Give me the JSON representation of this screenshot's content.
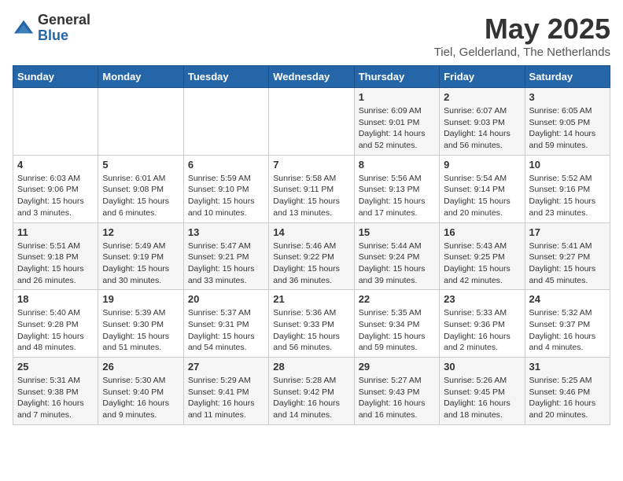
{
  "logo": {
    "general": "General",
    "blue": "Blue"
  },
  "title": "May 2025",
  "subtitle": "Tiel, Gelderland, The Netherlands",
  "days_of_week": [
    "Sunday",
    "Monday",
    "Tuesday",
    "Wednesday",
    "Thursday",
    "Friday",
    "Saturday"
  ],
  "weeks": [
    [
      {
        "day": "",
        "info": ""
      },
      {
        "day": "",
        "info": ""
      },
      {
        "day": "",
        "info": ""
      },
      {
        "day": "",
        "info": ""
      },
      {
        "day": "1",
        "info": "Sunrise: 6:09 AM\nSunset: 9:01 PM\nDaylight: 14 hours\nand 52 minutes."
      },
      {
        "day": "2",
        "info": "Sunrise: 6:07 AM\nSunset: 9:03 PM\nDaylight: 14 hours\nand 56 minutes."
      },
      {
        "day": "3",
        "info": "Sunrise: 6:05 AM\nSunset: 9:05 PM\nDaylight: 14 hours\nand 59 minutes."
      }
    ],
    [
      {
        "day": "4",
        "info": "Sunrise: 6:03 AM\nSunset: 9:06 PM\nDaylight: 15 hours\nand 3 minutes."
      },
      {
        "day": "5",
        "info": "Sunrise: 6:01 AM\nSunset: 9:08 PM\nDaylight: 15 hours\nand 6 minutes."
      },
      {
        "day": "6",
        "info": "Sunrise: 5:59 AM\nSunset: 9:10 PM\nDaylight: 15 hours\nand 10 minutes."
      },
      {
        "day": "7",
        "info": "Sunrise: 5:58 AM\nSunset: 9:11 PM\nDaylight: 15 hours\nand 13 minutes."
      },
      {
        "day": "8",
        "info": "Sunrise: 5:56 AM\nSunset: 9:13 PM\nDaylight: 15 hours\nand 17 minutes."
      },
      {
        "day": "9",
        "info": "Sunrise: 5:54 AM\nSunset: 9:14 PM\nDaylight: 15 hours\nand 20 minutes."
      },
      {
        "day": "10",
        "info": "Sunrise: 5:52 AM\nSunset: 9:16 PM\nDaylight: 15 hours\nand 23 minutes."
      }
    ],
    [
      {
        "day": "11",
        "info": "Sunrise: 5:51 AM\nSunset: 9:18 PM\nDaylight: 15 hours\nand 26 minutes."
      },
      {
        "day": "12",
        "info": "Sunrise: 5:49 AM\nSunset: 9:19 PM\nDaylight: 15 hours\nand 30 minutes."
      },
      {
        "day": "13",
        "info": "Sunrise: 5:47 AM\nSunset: 9:21 PM\nDaylight: 15 hours\nand 33 minutes."
      },
      {
        "day": "14",
        "info": "Sunrise: 5:46 AM\nSunset: 9:22 PM\nDaylight: 15 hours\nand 36 minutes."
      },
      {
        "day": "15",
        "info": "Sunrise: 5:44 AM\nSunset: 9:24 PM\nDaylight: 15 hours\nand 39 minutes."
      },
      {
        "day": "16",
        "info": "Sunrise: 5:43 AM\nSunset: 9:25 PM\nDaylight: 15 hours\nand 42 minutes."
      },
      {
        "day": "17",
        "info": "Sunrise: 5:41 AM\nSunset: 9:27 PM\nDaylight: 15 hours\nand 45 minutes."
      }
    ],
    [
      {
        "day": "18",
        "info": "Sunrise: 5:40 AM\nSunset: 9:28 PM\nDaylight: 15 hours\nand 48 minutes."
      },
      {
        "day": "19",
        "info": "Sunrise: 5:39 AM\nSunset: 9:30 PM\nDaylight: 15 hours\nand 51 minutes."
      },
      {
        "day": "20",
        "info": "Sunrise: 5:37 AM\nSunset: 9:31 PM\nDaylight: 15 hours\nand 54 minutes."
      },
      {
        "day": "21",
        "info": "Sunrise: 5:36 AM\nSunset: 9:33 PM\nDaylight: 15 hours\nand 56 minutes."
      },
      {
        "day": "22",
        "info": "Sunrise: 5:35 AM\nSunset: 9:34 PM\nDaylight: 15 hours\nand 59 minutes."
      },
      {
        "day": "23",
        "info": "Sunrise: 5:33 AM\nSunset: 9:36 PM\nDaylight: 16 hours\nand 2 minutes."
      },
      {
        "day": "24",
        "info": "Sunrise: 5:32 AM\nSunset: 9:37 PM\nDaylight: 16 hours\nand 4 minutes."
      }
    ],
    [
      {
        "day": "25",
        "info": "Sunrise: 5:31 AM\nSunset: 9:38 PM\nDaylight: 16 hours\nand 7 minutes."
      },
      {
        "day": "26",
        "info": "Sunrise: 5:30 AM\nSunset: 9:40 PM\nDaylight: 16 hours\nand 9 minutes."
      },
      {
        "day": "27",
        "info": "Sunrise: 5:29 AM\nSunset: 9:41 PM\nDaylight: 16 hours\nand 11 minutes."
      },
      {
        "day": "28",
        "info": "Sunrise: 5:28 AM\nSunset: 9:42 PM\nDaylight: 16 hours\nand 14 minutes."
      },
      {
        "day": "29",
        "info": "Sunrise: 5:27 AM\nSunset: 9:43 PM\nDaylight: 16 hours\nand 16 minutes."
      },
      {
        "day": "30",
        "info": "Sunrise: 5:26 AM\nSunset: 9:45 PM\nDaylight: 16 hours\nand 18 minutes."
      },
      {
        "day": "31",
        "info": "Sunrise: 5:25 AM\nSunset: 9:46 PM\nDaylight: 16 hours\nand 20 minutes."
      }
    ]
  ]
}
